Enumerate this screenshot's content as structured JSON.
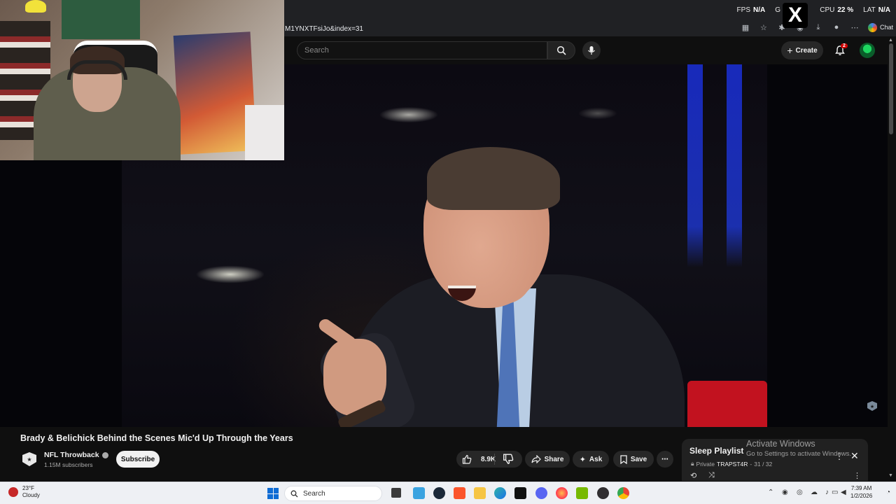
{
  "perf": {
    "fps_label": "FPS",
    "fps_value": "N/A",
    "gpu_label": "G",
    "cpu_label": "CPU",
    "cpu_value": "22 %",
    "lat_label": "LAT",
    "lat_value": "N/A"
  },
  "browser": {
    "url": "M1YNXTFsiJo&index=31",
    "chat_label": "Chat"
  },
  "header": {
    "search_placeholder": "Search",
    "create_label": "Create",
    "notification_count": "2"
  },
  "video": {
    "title": "Brady & Belichick Behind the Scenes Mic'd Up Through the Years",
    "channel_name": "NFL Throwback",
    "subscribers": "1.15M subscribers",
    "subscribe_label": "Subscribe",
    "likes": "8.9K",
    "share_label": "Share",
    "ask_label": "Ask",
    "save_label": "Save"
  },
  "playlist": {
    "title": "Sleep Playlist",
    "privacy": "Private",
    "owner": "TRAPST4R",
    "position": "31 / 32"
  },
  "watermark": {
    "line1": "Activate Windows",
    "line2": "Go to Settings to activate Windows."
  },
  "taskbar": {
    "temperature": "23°F",
    "condition": "Cloudy",
    "search_label": "Search",
    "time": "7:39 AM",
    "date": "1/2/2026"
  },
  "colors": {
    "yt_background": "#0f0f0f",
    "pill_background": "#272727",
    "notification_red": "#cc0000",
    "taskbar": "#eef0f4"
  }
}
